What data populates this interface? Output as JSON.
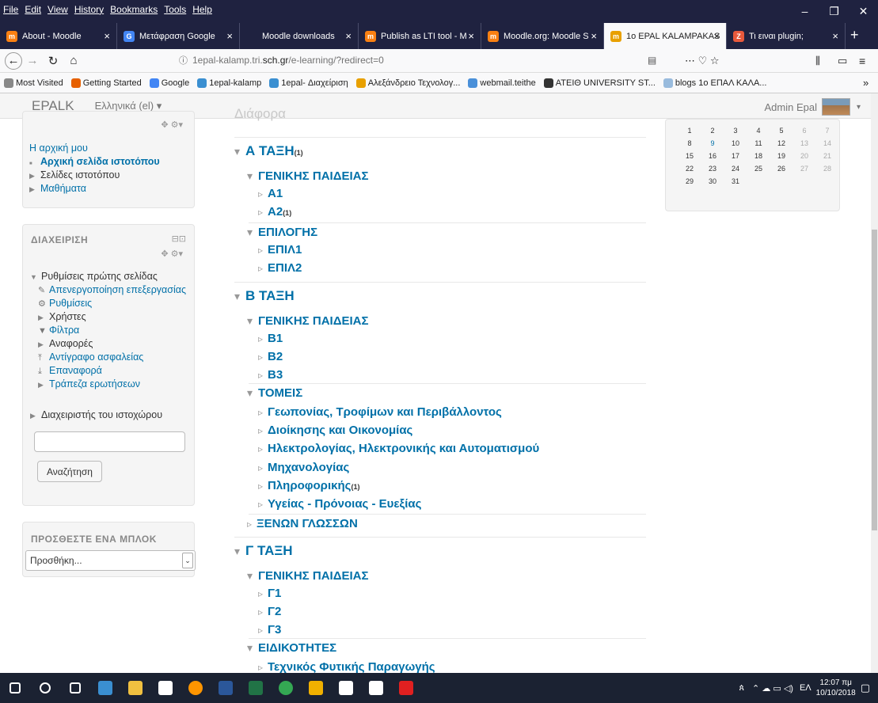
{
  "menu": [
    "File",
    "Edit",
    "View",
    "History",
    "Bookmarks",
    "Tools",
    "Help"
  ],
  "tabs": [
    {
      "label": "About - Moodle",
      "color": "#f98012",
      "glyph": "m"
    },
    {
      "label": "Μετάφραση Google",
      "color": "#4285f4",
      "glyph": "G"
    },
    {
      "label": "Moodle downloads",
      "color": "#1f2240",
      "glyph": ""
    },
    {
      "label": "Publish as LTI tool - M",
      "color": "#f98012",
      "glyph": "m"
    },
    {
      "label": "Moodle.org: Moodle S",
      "color": "#f98012",
      "glyph": "m"
    },
    {
      "label": "1o EPAL KALAMPAKAS",
      "color": "#e8a000",
      "glyph": "m"
    },
    {
      "label": "Τι ειναι plugin;",
      "color": "#e8593c",
      "glyph": "Z"
    }
  ],
  "url": {
    "prefix": "1epal-kalamp.tri.",
    "domain": "sch.gr",
    "suffix": "/e-learning/?redirect=0"
  },
  "bookmarks": [
    {
      "label": "Most Visited",
      "color": "#888"
    },
    {
      "label": "Getting Started",
      "color": "#e66000"
    },
    {
      "label": "Google",
      "color": "#4285f4"
    },
    {
      "label": "1epal-kalamp",
      "color": "#3a8fd1"
    },
    {
      "label": "1epal- Διαχείριση",
      "color": "#3a8fd1"
    },
    {
      "label": "Αλεξάνδρειο Τεχνολογ...",
      "color": "#e8a000"
    },
    {
      "label": "webmail.teithe",
      "color": "#4a90d9"
    },
    {
      "label": "ATEIΘ UNIVERSITY ST...",
      "color": "#333"
    },
    {
      "label": "blogs 1o ΕΠΑΛ ΚΑΛΑ...",
      "color": "#9bd"
    }
  ],
  "moodle": {
    "brand": "EPALK",
    "lang": "Ελληνικά (el) ▾",
    "user": "Admin Epal"
  },
  "nav_block": {
    "items": [
      {
        "label": "Η αρχική μου",
        "style": "link"
      },
      {
        "label": "Αρχική σελίδα ιστοτόπου",
        "style": "bold"
      },
      {
        "label": "Σελίδες ιστοτόπου",
        "style": "tri"
      },
      {
        "label": "Μαθήματα",
        "style": "trilink"
      }
    ]
  },
  "admin_block": {
    "title": "ΔΙΑΧΕΙΡΙΣΗ",
    "items": [
      {
        "label": "Ρυθμίσεις πρώτης σελίδας",
        "style": "open"
      },
      {
        "label": "Απενεργοποίηση επεξεργασίας",
        "style": "icon",
        "icon": "✎"
      },
      {
        "label": "Ρυθμίσεις",
        "style": "icon",
        "icon": "⚙"
      },
      {
        "label": "Χρήστες",
        "style": "tri"
      },
      {
        "label": "Φίλτρα",
        "style": "icon",
        "icon": "▼"
      },
      {
        "label": "Αναφορές",
        "style": "tri"
      },
      {
        "label": "Αντίγραφο ασφαλείας",
        "style": "icon",
        "icon": "⤒"
      },
      {
        "label": "Επαναφορά",
        "style": "icon",
        "icon": "⤓"
      },
      {
        "label": "Τράπεζα ερωτήσεων",
        "style": "trilink"
      }
    ],
    "site_admin": "Διαχειριστής του ιστοχώρου",
    "search_value": "",
    "search_button": "Αναζήτηση"
  },
  "add_block": {
    "title": "ΠΡΟΣΘΕΣΤΕ ΕΝΑ ΜΠΛΟΚ",
    "select": "Προσθήκη..."
  },
  "course_tree": [
    {
      "label": "Διάφορα",
      "level": 0,
      "partial": true
    },
    {
      "label": "Α ΤΑΞΗ",
      "level": 0,
      "count": "(1)"
    },
    {
      "label": "ΓΕΝΙΚΗΣ ΠΑΙΔΕΙΑΣ",
      "level": 1
    },
    {
      "label": "Α1",
      "level": 2
    },
    {
      "label": "Α2",
      "level": 2,
      "count": "(1)"
    },
    {
      "label": "ΕΠΙΛΟΓΗΣ",
      "level": 1
    },
    {
      "label": "ΕΠΙΛ1",
      "level": 2
    },
    {
      "label": "ΕΠΙΛ2",
      "level": 2
    },
    {
      "label": "Β ΤΑΞΗ",
      "level": 0
    },
    {
      "label": "ΓΕΝΙΚΗΣ ΠΑΙΔΕΙΑΣ",
      "level": 1
    },
    {
      "label": "Β1",
      "level": 2
    },
    {
      "label": "Β2",
      "level": 2
    },
    {
      "label": "Β3",
      "level": 2
    },
    {
      "label": "ΤΟΜΕΙΣ",
      "level": 1
    },
    {
      "label": "Γεωπονίας, Τροφίμων και Περιβάλλοντος",
      "level": 2
    },
    {
      "label": "Διοίκησης και Οικονομίας",
      "level": 2
    },
    {
      "label": "Ηλεκτρολογίας, Ηλεκτρονικής και Αυτοματισμού",
      "level": 2
    },
    {
      "label": "Μηχανολογίας",
      "level": 2
    },
    {
      "label": "Πληροφορικής",
      "level": 2,
      "count": "(1)"
    },
    {
      "label": "Υγείας - Πρόνοιας - Ευεξίας",
      "level": 2
    },
    {
      "label": "ΞΕΝΩΝ ΓΛΩΣΣΩΝ",
      "level": 1,
      "collapsed": true
    },
    {
      "label": "Γ ΤΑΞΗ",
      "level": 0
    },
    {
      "label": "ΓΕΝΙΚΗΣ ΠΑΙΔΕΙΑΣ",
      "level": 1
    },
    {
      "label": "Γ1",
      "level": 2
    },
    {
      "label": "Γ2",
      "level": 2
    },
    {
      "label": "Γ3",
      "level": 2
    },
    {
      "label": "ΕΙΔΙΚΟΤΗΤΕΣ",
      "level": 1
    },
    {
      "label": "Τεχνικός Φυτικής Παραγωγής",
      "level": 2
    }
  ],
  "calendar": {
    "weeks": [
      [
        "1",
        "2",
        "3",
        "4",
        "5",
        "6",
        "7"
      ],
      [
        "8",
        "9",
        "10",
        "11",
        "12",
        "13",
        "14"
      ],
      [
        "15",
        "16",
        "17",
        "18",
        "19",
        "20",
        "21"
      ],
      [
        "22",
        "23",
        "24",
        "25",
        "26",
        "27",
        "28"
      ],
      [
        "29",
        "30",
        "31",
        "",
        "",
        "",
        ""
      ]
    ],
    "today": "9"
  },
  "taskbar": {
    "apps": [
      {
        "name": "windows-start",
        "color": "#ffffff"
      },
      {
        "name": "search",
        "color": "#ffffff"
      },
      {
        "name": "task-view",
        "color": "#ffffff"
      },
      {
        "name": "edge",
        "color": "#3a8fd1"
      },
      {
        "name": "file-explorer",
        "color": "#f0c040"
      },
      {
        "name": "store",
        "color": "#ffffff"
      },
      {
        "name": "firefox",
        "color": "#ff9500"
      },
      {
        "name": "word",
        "color": "#2b579a"
      },
      {
        "name": "excel",
        "color": "#217346"
      },
      {
        "name": "chrome",
        "color": "#34a853"
      },
      {
        "name": "outlook",
        "color": "#f0b000"
      },
      {
        "name": "notepad",
        "color": "#ffffff"
      },
      {
        "name": "app",
        "color": "#ffffff"
      },
      {
        "name": "acrobat",
        "color": "#e02020"
      }
    ],
    "lang": "ΕΛ",
    "time": "12:07 πμ",
    "date": "10/10/2018"
  }
}
